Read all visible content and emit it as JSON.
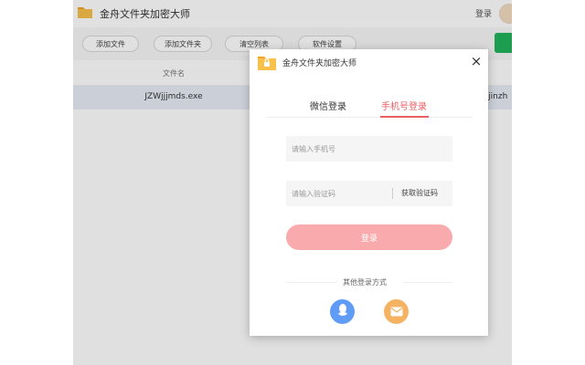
{
  "app": {
    "title": "金舟文件夹加密大师",
    "login_label": "登录"
  },
  "toolbar": {
    "add_file": "添加文件",
    "add_folder": "添加文件夹",
    "clear_list": "清空列表",
    "settings": "软件设置"
  },
  "table": {
    "header_filename": "文件名",
    "row": {
      "filename": "JZWjjjmds.exe",
      "path_fragment": "Ajinzh"
    }
  },
  "dialog": {
    "title": "金舟文件夹加密大师",
    "close_symbol": "×",
    "tabs": [
      {
        "label": "微信登录",
        "active": false
      },
      {
        "label": "手机号登录",
        "active": true
      }
    ],
    "phone_placeholder": "请输入手机号",
    "code_placeholder": "请输入验证码",
    "get_code_label": "获取验证码",
    "login_button": "登录",
    "other_methods_label": "其他登录方式",
    "icons": [
      "qq-icon",
      "mail-icon"
    ]
  },
  "colors": {
    "accent": "#ea5d62",
    "login_button": "#f8aaad",
    "qq": "#5f9cf6",
    "mail": "#f5b263",
    "toolbar_green": "#21b35a",
    "selected_row": "#e7edf6"
  }
}
